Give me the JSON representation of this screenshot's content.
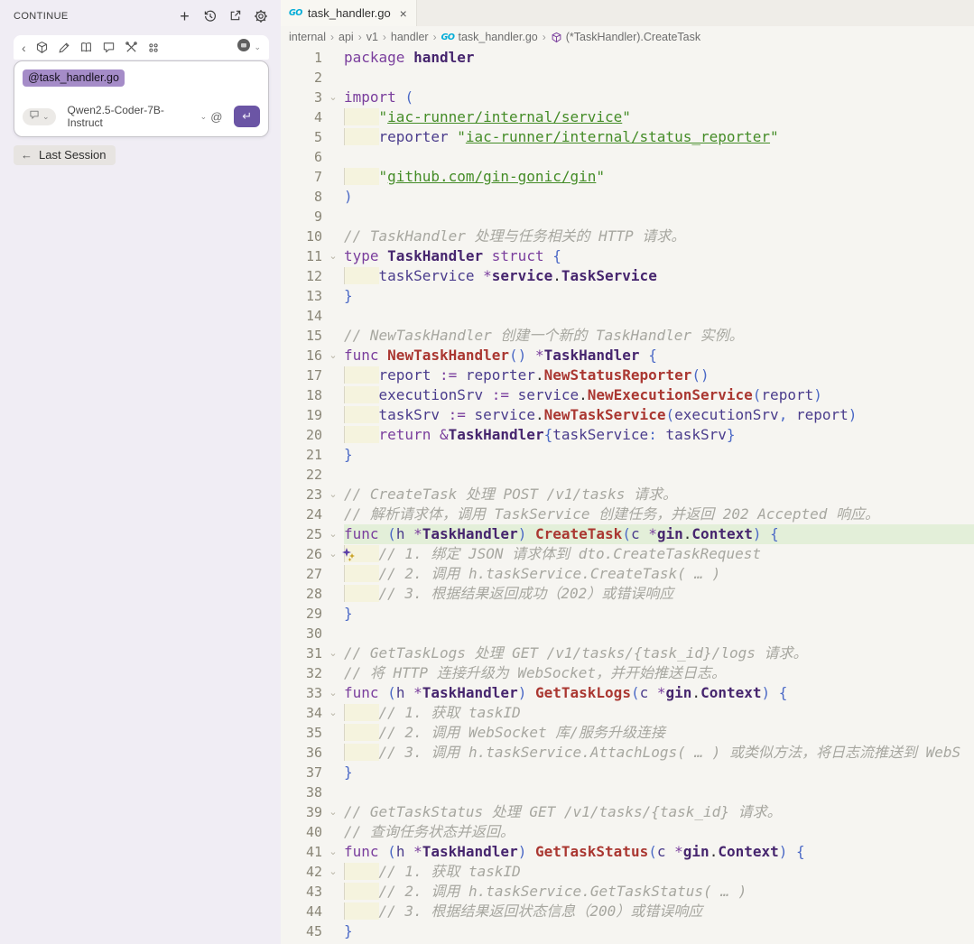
{
  "sidebar": {
    "title": "CONTINUE",
    "context_chip": "@task_handler.go",
    "model": "Qwen2.5-Coder-7B-Instruct",
    "last_session": "Last Session"
  },
  "icons": {
    "add": "+",
    "close": "×",
    "chevron_down": "⌄",
    "chevron_left": "‹",
    "back_arrow": "←",
    "at": "@",
    "enter": "↵",
    "go": "GO",
    "crumb_sep": "›",
    "fold": "⌄"
  },
  "colors": {
    "accent_purple": "#6B55A5",
    "chip_bg": "#A58CC8",
    "go_cyan": "#00ACD7",
    "keyword": "#7A3E9D",
    "type": "#46256E",
    "function": "#AA3731",
    "string": "#448C27",
    "comment": "#A7A7A0",
    "line_highlight": "#E3EFD9",
    "indent_highlight": "#F5F3DE",
    "sidebar_bg": "#F0EDF4",
    "editor_bg": "#F6F5F1"
  },
  "editor": {
    "tab": {
      "label": "task_handler.go"
    },
    "breadcrumb": [
      {
        "label": "internal"
      },
      {
        "label": "api"
      },
      {
        "label": "v1"
      },
      {
        "label": "handler"
      },
      {
        "label": "task_handler.go",
        "icon": "go"
      },
      {
        "label": "(*TaskHandler).CreateTask",
        "icon": "symbol"
      }
    ],
    "code": {
      "language": "go",
      "lines": [
        {
          "n": 1,
          "tk": [
            [
              "k",
              "package"
            ],
            [
              "d",
              " "
            ],
            [
              "t",
              "handler"
            ]
          ]
        },
        {
          "n": 2,
          "tk": []
        },
        {
          "n": 3,
          "fold": true,
          "tk": [
            [
              "k",
              "import"
            ],
            [
              "d",
              " "
            ],
            [
              "p",
              "("
            ]
          ]
        },
        {
          "n": 4,
          "ind": true,
          "tk": [
            [
              "s",
              "\""
            ],
            [
              "u",
              "iac-runner/internal/service"
            ],
            [
              "s",
              "\""
            ]
          ]
        },
        {
          "n": 5,
          "ind": true,
          "tk": [
            [
              "v",
              "reporter"
            ],
            [
              "d",
              " "
            ],
            [
              "s",
              "\""
            ],
            [
              "u",
              "iac-runner/internal/status_reporter"
            ],
            [
              "s",
              "\""
            ]
          ]
        },
        {
          "n": 6,
          "tk": []
        },
        {
          "n": 7,
          "ind": true,
          "tk": [
            [
              "s",
              "\""
            ],
            [
              "u",
              "github.com/gin-gonic/gin"
            ],
            [
              "s",
              "\""
            ]
          ]
        },
        {
          "n": 8,
          "tk": [
            [
              "p",
              ")"
            ]
          ]
        },
        {
          "n": 9,
          "tk": []
        },
        {
          "n": 10,
          "tk": [
            [
              "c",
              "// TaskHandler 处理与任务相关的 HTTP 请求。"
            ]
          ]
        },
        {
          "n": 11,
          "fold": true,
          "tk": [
            [
              "k",
              "type"
            ],
            [
              "d",
              " "
            ],
            [
              "t",
              "TaskHandler"
            ],
            [
              "d",
              " "
            ],
            [
              "k",
              "struct"
            ],
            [
              "d",
              " "
            ],
            [
              "p",
              "{"
            ]
          ]
        },
        {
          "n": 12,
          "ind": true,
          "tk": [
            [
              "v",
              "taskService"
            ],
            [
              "d",
              " "
            ],
            [
              "k",
              "*"
            ],
            [
              "t",
              "service"
            ],
            [
              "d",
              "."
            ],
            [
              "t",
              "TaskService"
            ]
          ]
        },
        {
          "n": 13,
          "tk": [
            [
              "p",
              "}"
            ]
          ]
        },
        {
          "n": 14,
          "tk": []
        },
        {
          "n": 15,
          "tk": [
            [
              "c",
              "// NewTaskHandler 创建一个新的 TaskHandler 实例。"
            ]
          ]
        },
        {
          "n": 16,
          "fold": true,
          "tk": [
            [
              "k",
              "func"
            ],
            [
              "d",
              " "
            ],
            [
              "f",
              "NewTaskHandler"
            ],
            [
              "p",
              "()"
            ],
            [
              "d",
              " "
            ],
            [
              "k",
              "*"
            ],
            [
              "t",
              "TaskHandler"
            ],
            [
              "d",
              " "
            ],
            [
              "p",
              "{"
            ]
          ]
        },
        {
          "n": 17,
          "ind": true,
          "tk": [
            [
              "v",
              "report"
            ],
            [
              "d",
              " "
            ],
            [
              "k",
              ":="
            ],
            [
              "d",
              " "
            ],
            [
              "v",
              "reporter"
            ],
            [
              "d",
              "."
            ],
            [
              "f",
              "NewStatusReporter"
            ],
            [
              "p",
              "()"
            ]
          ]
        },
        {
          "n": 18,
          "ind": true,
          "tk": [
            [
              "v",
              "executionSrv"
            ],
            [
              "d",
              " "
            ],
            [
              "k",
              ":="
            ],
            [
              "d",
              " "
            ],
            [
              "v",
              "service"
            ],
            [
              "d",
              "."
            ],
            [
              "f",
              "NewExecutionService"
            ],
            [
              "p",
              "("
            ],
            [
              "v",
              "report"
            ],
            [
              "p",
              ")"
            ]
          ]
        },
        {
          "n": 19,
          "ind": true,
          "tk": [
            [
              "v",
              "taskSrv"
            ],
            [
              "d",
              " "
            ],
            [
              "k",
              ":="
            ],
            [
              "d",
              " "
            ],
            [
              "v",
              "service"
            ],
            [
              "d",
              "."
            ],
            [
              "f",
              "NewTaskService"
            ],
            [
              "p",
              "("
            ],
            [
              "v",
              "executionSrv"
            ],
            [
              "p",
              ","
            ],
            [
              "d",
              " "
            ],
            [
              "v",
              "report"
            ],
            [
              "p",
              ")"
            ]
          ]
        },
        {
          "n": 20,
          "ind": true,
          "tk": [
            [
              "k",
              "return"
            ],
            [
              "d",
              " "
            ],
            [
              "k",
              "&"
            ],
            [
              "t",
              "TaskHandler"
            ],
            [
              "p",
              "{"
            ],
            [
              "v",
              "taskService"
            ],
            [
              "p",
              ":"
            ],
            [
              "d",
              " "
            ],
            [
              "v",
              "taskSrv"
            ],
            [
              "p",
              "}"
            ]
          ]
        },
        {
          "n": 21,
          "tk": [
            [
              "p",
              "}"
            ]
          ]
        },
        {
          "n": 22,
          "tk": []
        },
        {
          "n": 23,
          "fold": true,
          "tk": [
            [
              "c",
              "// CreateTask 处理 POST /v1/tasks 请求。"
            ]
          ]
        },
        {
          "n": 24,
          "tk": [
            [
              "c",
              "// 解析请求体，调用 TaskService 创建任务，并返回 202 Accepted 响应。"
            ]
          ]
        },
        {
          "n": 25,
          "fold": true,
          "hl": true,
          "tk": [
            [
              "k",
              "func"
            ],
            [
              "d",
              " "
            ],
            [
              "p",
              "("
            ],
            [
              "v",
              "h"
            ],
            [
              "d",
              " "
            ],
            [
              "k",
              "*"
            ],
            [
              "t",
              "TaskHandler"
            ],
            [
              "p",
              ")"
            ],
            [
              "d",
              " "
            ],
            [
              "f",
              "CreateTask"
            ],
            [
              "p",
              "("
            ],
            [
              "v",
              "c"
            ],
            [
              "d",
              " "
            ],
            [
              "k",
              "*"
            ],
            [
              "t",
              "gin"
            ],
            [
              "d",
              "."
            ],
            [
              "t",
              "Context"
            ],
            [
              "p",
              ")"
            ],
            [
              "d",
              " "
            ],
            [
              "p",
              "{"
            ]
          ]
        },
        {
          "n": 26,
          "fold": true,
          "sp": true,
          "ind": true,
          "tk": [
            [
              "c",
              "// 1. 绑定 JSON 请求体到 dto.CreateTaskRequest"
            ]
          ]
        },
        {
          "n": 27,
          "ind": true,
          "tk": [
            [
              "c",
              "// 2. 调用 h.taskService.CreateTask( … )"
            ]
          ]
        },
        {
          "n": 28,
          "ind": true,
          "tk": [
            [
              "c",
              "// 3. 根据结果返回成功（202）或错误响应"
            ]
          ]
        },
        {
          "n": 29,
          "tk": [
            [
              "p",
              "}"
            ]
          ]
        },
        {
          "n": 30,
          "tk": []
        },
        {
          "n": 31,
          "fold": true,
          "tk": [
            [
              "c",
              "// GetTaskLogs 处理 GET /v1/tasks/{task_id}/logs 请求。"
            ]
          ]
        },
        {
          "n": 32,
          "tk": [
            [
              "c",
              "// 将 HTTP 连接升级为 WebSocket，并开始推送日志。"
            ]
          ]
        },
        {
          "n": 33,
          "fold": true,
          "tk": [
            [
              "k",
              "func"
            ],
            [
              "d",
              " "
            ],
            [
              "p",
              "("
            ],
            [
              "v",
              "h"
            ],
            [
              "d",
              " "
            ],
            [
              "k",
              "*"
            ],
            [
              "t",
              "TaskHandler"
            ],
            [
              "p",
              ")"
            ],
            [
              "d",
              " "
            ],
            [
              "f",
              "GetTaskLogs"
            ],
            [
              "p",
              "("
            ],
            [
              "v",
              "c"
            ],
            [
              "d",
              " "
            ],
            [
              "k",
              "*"
            ],
            [
              "t",
              "gin"
            ],
            [
              "d",
              "."
            ],
            [
              "t",
              "Context"
            ],
            [
              "p",
              ")"
            ],
            [
              "d",
              " "
            ],
            [
              "p",
              "{"
            ]
          ]
        },
        {
          "n": 34,
          "fold": true,
          "ind": true,
          "tk": [
            [
              "c",
              "// 1. 获取 taskID"
            ]
          ]
        },
        {
          "n": 35,
          "ind": true,
          "tk": [
            [
              "c",
              "// 2. 调用 WebSocket 库/服务升级连接"
            ]
          ]
        },
        {
          "n": 36,
          "ind": true,
          "tk": [
            [
              "c",
              "// 3. 调用 h.taskService.AttachLogs( … ) 或类似方法，将日志流推送到 WebS"
            ]
          ]
        },
        {
          "n": 37,
          "tk": [
            [
              "p",
              "}"
            ]
          ]
        },
        {
          "n": 38,
          "tk": []
        },
        {
          "n": 39,
          "fold": true,
          "tk": [
            [
              "c",
              "// GetTaskStatus 处理 GET /v1/tasks/{task_id} 请求。"
            ]
          ]
        },
        {
          "n": 40,
          "tk": [
            [
              "c",
              "// 查询任务状态并返回。"
            ]
          ]
        },
        {
          "n": 41,
          "fold": true,
          "tk": [
            [
              "k",
              "func"
            ],
            [
              "d",
              " "
            ],
            [
              "p",
              "("
            ],
            [
              "v",
              "h"
            ],
            [
              "d",
              " "
            ],
            [
              "k",
              "*"
            ],
            [
              "t",
              "TaskHandler"
            ],
            [
              "p",
              ")"
            ],
            [
              "d",
              " "
            ],
            [
              "f",
              "GetTaskStatus"
            ],
            [
              "p",
              "("
            ],
            [
              "v",
              "c"
            ],
            [
              "d",
              " "
            ],
            [
              "k",
              "*"
            ],
            [
              "t",
              "gin"
            ],
            [
              "d",
              "."
            ],
            [
              "t",
              "Context"
            ],
            [
              "p",
              ")"
            ],
            [
              "d",
              " "
            ],
            [
              "p",
              "{"
            ]
          ]
        },
        {
          "n": 42,
          "fold": true,
          "ind": true,
          "tk": [
            [
              "c",
              "// 1. 获取 taskID"
            ]
          ]
        },
        {
          "n": 43,
          "ind": true,
          "tk": [
            [
              "c",
              "// 2. 调用 h.taskService.GetTaskStatus( … )"
            ]
          ]
        },
        {
          "n": 44,
          "ind": true,
          "tk": [
            [
              "c",
              "// 3. 根据结果返回状态信息（200）或错误响应"
            ]
          ]
        },
        {
          "n": 45,
          "tk": [
            [
              "p",
              "}"
            ]
          ]
        }
      ]
    }
  }
}
